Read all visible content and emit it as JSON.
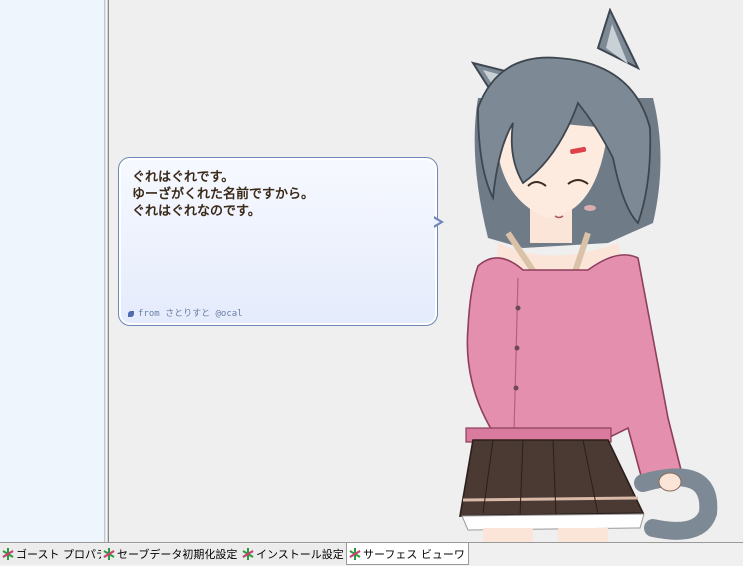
{
  "balloon": {
    "lines": [
      "ぐれはぐれです。",
      "ゆーざがくれた名前ですから。",
      "ぐれはぐれなのです。"
    ],
    "signature": "from さとりすと @ocal"
  },
  "tabs": [
    {
      "label": "ゴースト プロパティ",
      "active": false
    },
    {
      "label": "セーブデータ初期化設定",
      "active": false
    },
    {
      "label": "インストール設定",
      "active": false
    },
    {
      "label": "サーフェス ビューワ",
      "active": true
    }
  ],
  "colors": {
    "left_pane": "#eef5fd",
    "main_area": "#f0eff0",
    "balloon_border": "#6f86b8",
    "hair": "#7d8a96",
    "cardigan": "#e58fae",
    "skirt": "#4a3a33"
  },
  "icons": {
    "tab_icon": "ghost-logo-icon",
    "signature_icon": "leaf-icon"
  }
}
